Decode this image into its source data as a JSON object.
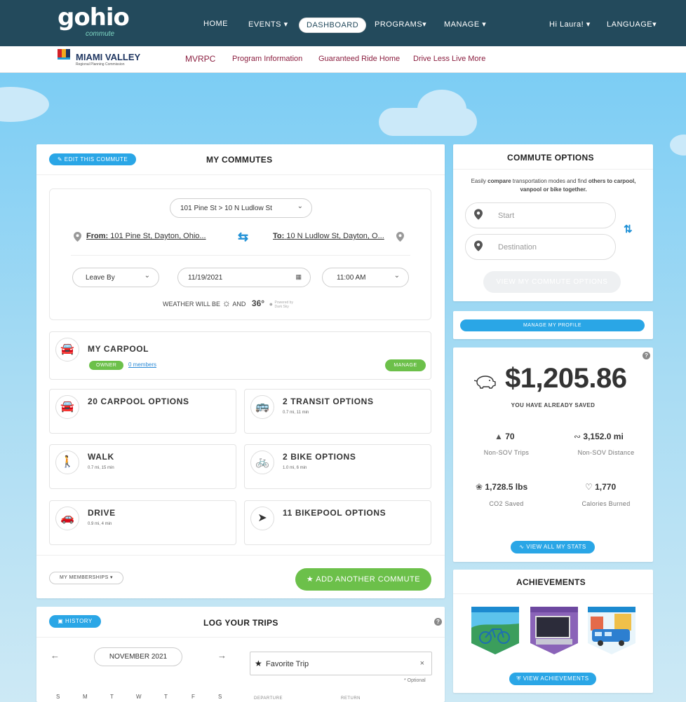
{
  "header": {
    "logo_text": "gohio",
    "logo_sub": "commute",
    "nav": [
      "HOME",
      "EVENTS ▾",
      "DASHBOARD",
      "PROGRAMS▾",
      "MANAGE ▾",
      "Hi Laura! ▾",
      "LANGUAGE▾"
    ]
  },
  "subnav": {
    "org_name": "MIAMI VALLEY",
    "org_sub": "Regional Planning Commission",
    "links": [
      "MVRPC",
      "Program Information",
      "Guaranteed Ride Home",
      "Drive Less Live More"
    ]
  },
  "commutes": {
    "edit_label": "EDIT THIS COMMUTE",
    "title": "MY COMMUTES",
    "route_select": "101 Pine St > 10 N Ludlow St",
    "from_prefix": "From:",
    "from": "101 Pine St, Dayton, Ohio...",
    "to_prefix": "To:",
    "to": "10 N Ludlow St, Dayton, O...",
    "leave_by": "Leave By",
    "date": "11/19/2021",
    "time": "11:00 AM",
    "weather_prefix": "WEATHER WILL BE",
    "weather_and": "AND",
    "temp": "36°",
    "powered": "Powered by",
    "powered_name": "Dark Sky"
  },
  "carpool": {
    "title": "MY CARPOOL",
    "owner": "OWNER",
    "members": "0 members",
    "manage": "MANAGE"
  },
  "options": [
    {
      "title": "20 CARPOOL OPTIONS",
      "sub": "",
      "icon": "carpool-icon"
    },
    {
      "title": "2 TRANSIT OPTIONS",
      "sub": "0.7 mi, 11 min",
      "icon": "bus-icon"
    },
    {
      "title": "WALK",
      "sub": "0.7 mi, 15 min",
      "icon": "walk-icon"
    },
    {
      "title": "2 BIKE OPTIONS",
      "sub": "1.0 mi, 6 min",
      "icon": "bike-icon"
    },
    {
      "title": "DRIVE",
      "sub": "0.9 mi, 4 min",
      "icon": "car-icon"
    },
    {
      "title": "11 BIKEPOOL OPTIONS",
      "sub": "",
      "icon": "navigation-arrow-icon"
    }
  ],
  "memberships": "MY MEMBERSHIPS ▾",
  "add_commute": "ADD ANOTHER COMMUTE",
  "log": {
    "history": "HISTORY",
    "title": "LOG YOUR TRIPS",
    "month": "NOVEMBER 2021",
    "days": [
      "S",
      "M",
      "T",
      "W",
      "T",
      "F",
      "S"
    ],
    "favorite": "Favorite Trip",
    "optional": "* Optional",
    "departure": "DEPARTURE",
    "return": "RETURN"
  },
  "options_panel": {
    "title": "COMMUTE OPTIONS",
    "desc_1": "Easily",
    "desc_2": "compare",
    "desc_3": "transportation modes and find",
    "desc_4": "others to carpool,",
    "desc_5": "vanpool or bike together.",
    "start": "Start",
    "destination": "Destination",
    "view": "VIEW MY COMMUTE OPTIONS"
  },
  "profile": "MANAGE MY PROFILE",
  "savings": {
    "amount": "$1,205.86",
    "label": "YOU HAVE ALREADY SAVED",
    "trips": "70",
    "trips_label": "Non-SOV Trips",
    "distance": "3,152.0 mi",
    "distance_label": "Non-SOV Distance",
    "co2": "1,728.5 lbs",
    "co2_label": "CO2 Saved",
    "calories": "1,770",
    "calories_label": "Calories Burned",
    "view_stats": "VIEW ALL MY STATS"
  },
  "achievements": {
    "title": "ACHIEVEMENTS",
    "view": "VIEW ACHIEVEMENTS"
  }
}
